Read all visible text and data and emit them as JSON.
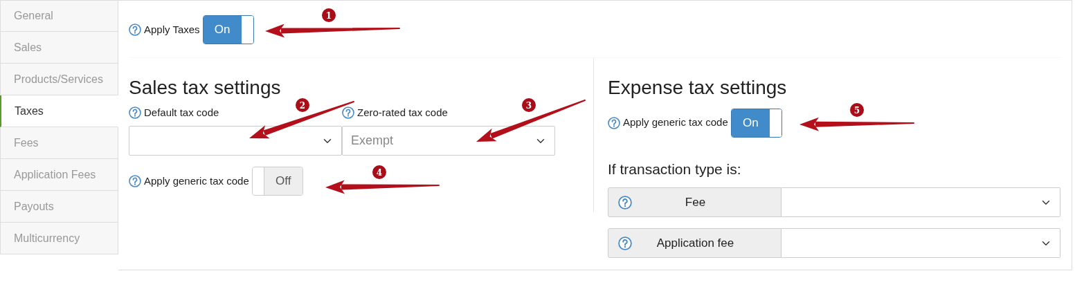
{
  "sidebar": {
    "items": [
      {
        "label": "General",
        "selected": false
      },
      {
        "label": "Sales",
        "selected": false
      },
      {
        "label": "Products/Services",
        "selected": false
      },
      {
        "label": "Taxes",
        "selected": true
      },
      {
        "label": "Fees",
        "selected": false
      },
      {
        "label": "Application Fees",
        "selected": false
      },
      {
        "label": "Payouts",
        "selected": false
      },
      {
        "label": "Multicurrency",
        "selected": false
      }
    ]
  },
  "apply_taxes": {
    "label": "Apply Taxes",
    "on": true,
    "toggle_label": "On"
  },
  "sales": {
    "title": "Sales tax settings",
    "fields": [
      {
        "label": "Default tax code"
      },
      {
        "label": "Zero-rated tax code",
        "value": "Exempt"
      }
    ],
    "generic": {
      "label": "Apply generic tax code",
      "on": false,
      "toggle_label": "Off"
    }
  },
  "expense": {
    "title": "Expense tax settings",
    "generic": {
      "label": "Apply generic tax code",
      "on": true,
      "toggle_label": "On"
    },
    "subtitle": "If transaction type is:",
    "rows": [
      {
        "label": "Fee"
      },
      {
        "label": "Application fee"
      }
    ]
  },
  "annotations": [
    {
      "number": "1"
    },
    {
      "number": "2"
    },
    {
      "number": "3"
    },
    {
      "number": "4"
    },
    {
      "number": "5"
    }
  ]
}
